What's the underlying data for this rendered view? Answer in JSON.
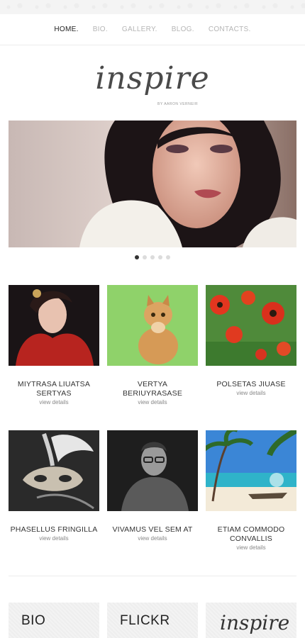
{
  "nav": {
    "items": [
      "HOME.",
      "BIO.",
      "GALLERY.",
      "BLOG.",
      "CONTACTS."
    ],
    "active_index": 0
  },
  "brand": {
    "title": "inspire",
    "byline": "BY AARON VERNEIR"
  },
  "slider": {
    "image": "portrait-woman-fur-photo",
    "dots_count": 5,
    "active_dot": 0
  },
  "gallery": {
    "items": [
      {
        "title": "MIYTRASA LIUATSA SERTYAS",
        "link": "view details",
        "image": "woman-red-fur-photo"
      },
      {
        "title": "VERTYA BERIUYRASASE",
        "link": "view details",
        "image": "ginger-cat-photo"
      },
      {
        "title": "POLSETAS JIUASE",
        "link": "view details",
        "image": "red-poppies-photo"
      },
      {
        "title": "PHASELLUS FRINGILLA",
        "link": "view details",
        "image": "venetian-mask-photo"
      },
      {
        "title": "VIVAMUS VEL SEM AT",
        "link": "view details",
        "image": "man-glasses-photo"
      },
      {
        "title": "ETIAM COMMODO CONVALLIS",
        "link": "view details",
        "image": "tropical-beach-photo"
      }
    ]
  },
  "footer_tiles": {
    "bio": "BIO",
    "flickr": "FLICKR",
    "logo": "inspire"
  },
  "colors": {
    "nav_active": "#222222",
    "nav_inactive": "#b5b5b5",
    "background": "#ffffff"
  }
}
